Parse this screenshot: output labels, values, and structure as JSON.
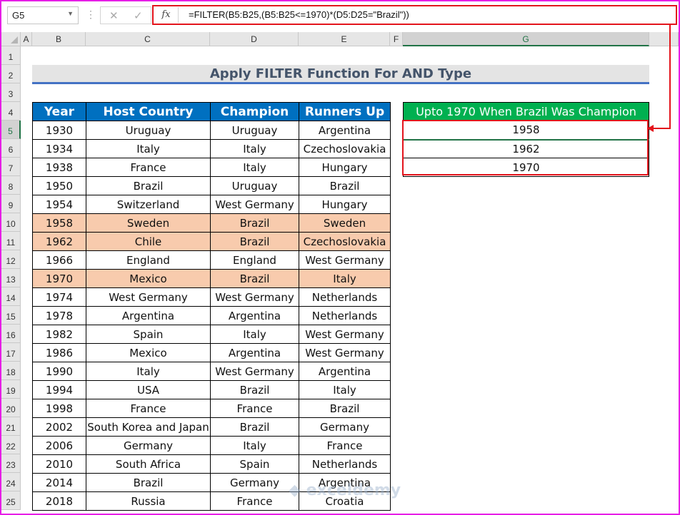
{
  "formula_bar": {
    "name_box": "G5",
    "fx_label": "fx",
    "formula": "=FILTER(B5:B25,(B5:B25<=1970)*(D5:D25=\"Brazil\"))",
    "cancel": "✕",
    "enter": "✓"
  },
  "columns": [
    "A",
    "B",
    "C",
    "D",
    "E",
    "F",
    "G"
  ],
  "rows": [
    "1",
    "2",
    "3",
    "4",
    "5",
    "6",
    "7",
    "8",
    "9",
    "10",
    "11",
    "12",
    "13",
    "14",
    "15",
    "16",
    "17",
    "18",
    "19",
    "20",
    "21",
    "22",
    "23",
    "24",
    "25"
  ],
  "title": "Apply FILTER Function For AND Type",
  "table": {
    "headers": [
      "Year",
      "Host Country",
      "Champion",
      "Runners Up"
    ],
    "rows": [
      [
        "1930",
        "Uruguay",
        "Uruguay",
        "Argentina"
      ],
      [
        "1934",
        "Italy",
        "Italy",
        "Czechoslovakia"
      ],
      [
        "1938",
        "France",
        "Italy",
        "Hungary"
      ],
      [
        "1950",
        "Brazil",
        "Uruguay",
        "Brazil"
      ],
      [
        "1954",
        "Switzerland",
        "West Germany",
        "Hungary"
      ],
      [
        "1958",
        "Sweden",
        "Brazil",
        "Sweden"
      ],
      [
        "1962",
        "Chile",
        "Brazil",
        "Czechoslovakia"
      ],
      [
        "1966",
        "England",
        "England",
        "West Germany"
      ],
      [
        "1970",
        "Mexico",
        "Brazil",
        "Italy"
      ],
      [
        "1974",
        "West Germany",
        "West Germany",
        "Netherlands"
      ],
      [
        "1978",
        "Argentina",
        "Argentina",
        "Netherlands"
      ],
      [
        "1982",
        "Spain",
        "Italy",
        "West Germany"
      ],
      [
        "1986",
        "Mexico",
        "Argentina",
        "West Germany"
      ],
      [
        "1990",
        "Italy",
        "West Germany",
        "Argentina"
      ],
      [
        "1994",
        "USA",
        "Brazil",
        "Italy"
      ],
      [
        "1998",
        "France",
        "France",
        "Brazil"
      ],
      [
        "2002",
        "South Korea and Japan",
        "Brazil",
        "Germany"
      ],
      [
        "2006",
        "Germany",
        "Italy",
        "France"
      ],
      [
        "2010",
        "South Africa",
        "Spain",
        "Netherlands"
      ],
      [
        "2014",
        "Brazil",
        "Germany",
        "Argentina"
      ],
      [
        "2018",
        "Russia",
        "France",
        "Croatia"
      ]
    ],
    "highlighted_rows": [
      5,
      6,
      8
    ],
    "highlight_color": "#f8cbad",
    "header_color": "#0070c0"
  },
  "result": {
    "header": "Upto 1970 When Brazil Was Champion",
    "values": [
      "1958",
      "1962",
      "1970"
    ],
    "header_color": "#00b050"
  },
  "watermark": "exceldemy"
}
